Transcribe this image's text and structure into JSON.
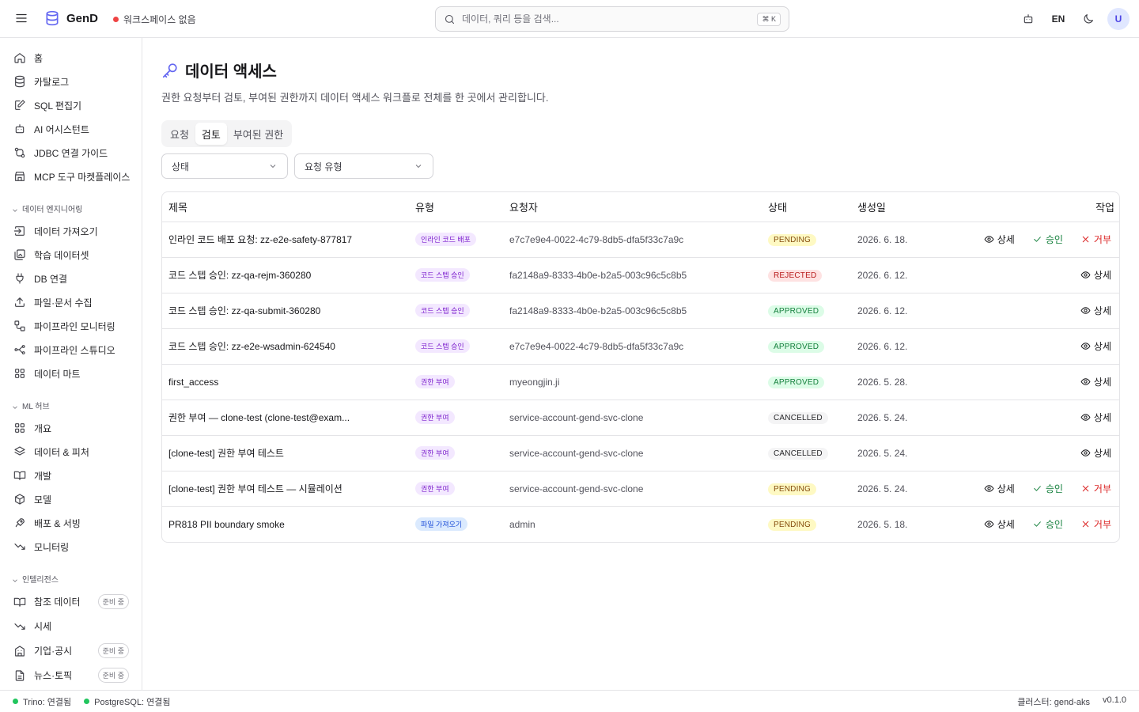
{
  "header": {
    "app_name": "GenD",
    "workspace": "워크스페이스 없음",
    "search_placeholder": "데이터, 쿼리 등을 검색...",
    "search_shortcut": "⌘ K",
    "lang": "EN",
    "avatar_initial": "U"
  },
  "sidebar": {
    "top_items": [
      {
        "label": "홈",
        "icon": "home-icon"
      },
      {
        "label": "카탈로그",
        "icon": "database-icon"
      },
      {
        "label": "SQL 편집기",
        "icon": "edit-icon"
      },
      {
        "label": "AI 어시스턴트",
        "icon": "bot-icon"
      },
      {
        "label": "JDBC 연결 가이드",
        "icon": "link-icon"
      },
      {
        "label": "MCP 도구 마켓플레이스",
        "icon": "store-icon"
      }
    ],
    "sections": [
      {
        "label": "데이터 엔지니어링",
        "items": [
          {
            "label": "데이터 가져오기",
            "icon": "import-icon"
          },
          {
            "label": "학습 데이터셋",
            "icon": "images-icon"
          },
          {
            "label": "DB 연결",
            "icon": "plug-icon"
          },
          {
            "label": "파일·문서 수집",
            "icon": "upload-icon"
          },
          {
            "label": "파이프라인 모니터링",
            "icon": "workflow-icon"
          },
          {
            "label": "파이프라인 스튜디오",
            "icon": "pipeline-icon"
          },
          {
            "label": "데이터 마트",
            "icon": "grid-icon"
          }
        ]
      },
      {
        "label": "ML 허브",
        "items": [
          {
            "label": "개요",
            "icon": "grid-icon"
          },
          {
            "label": "데이터 & 피처",
            "icon": "layers-icon"
          },
          {
            "label": "개발",
            "icon": "book-icon"
          },
          {
            "label": "모델",
            "icon": "box-icon"
          },
          {
            "label": "배포 & 서빙",
            "icon": "rocket-icon"
          },
          {
            "label": "모니터링",
            "icon": "trending-down-icon"
          }
        ]
      },
      {
        "label": "인텔리전스",
        "items": [
          {
            "label": "참조 데이터",
            "icon": "book-icon",
            "badge": "준비 중"
          },
          {
            "label": "시세",
            "icon": "trending-down-icon"
          },
          {
            "label": "기업·공시",
            "icon": "building-icon",
            "badge": "준비 중"
          },
          {
            "label": "뉴스·토픽",
            "icon": "file-icon",
            "badge": "준비 중"
          }
        ]
      }
    ]
  },
  "page": {
    "title": "데이터 액세스",
    "subtitle": "권한 요청부터 검토, 부여된 권한까지 데이터 액세스 워크플로 전체를 한 곳에서 관리합니다.",
    "tabs": [
      "요청",
      "검토",
      "부여된 권한"
    ],
    "active_tab": "검토",
    "filters": {
      "status": "상태",
      "request_type": "요청 유형"
    }
  },
  "table": {
    "columns": [
      "제목",
      "유형",
      "요청자",
      "상태",
      "생성일",
      "작업"
    ],
    "actions": {
      "view": "상세",
      "approve": "승인",
      "reject": "거부"
    },
    "rows": [
      {
        "title": "인라인 코드 배포 요청: zz-e2e-safety-877817",
        "type": "인라인 코드 배포",
        "type_color": "purple",
        "requester": "e7c7e9e4-0022-4c79-8db5-dfa5f33c7a9c",
        "status": "PENDING",
        "date": "2026. 6. 18."
      },
      {
        "title": "코드 스텝 승인: zz-qa-rejm-360280",
        "type": "코드 스텝 승인",
        "type_color": "purple",
        "requester": "fa2148a9-8333-4b0e-b2a5-003c96c5c8b5",
        "status": "REJECTED",
        "date": "2026. 6. 12."
      },
      {
        "title": "코드 스텝 승인: zz-qa-submit-360280",
        "type": "코드 스텝 승인",
        "type_color": "purple",
        "requester": "fa2148a9-8333-4b0e-b2a5-003c96c5c8b5",
        "status": "APPROVED",
        "date": "2026. 6. 12."
      },
      {
        "title": "코드 스텝 승인: zz-e2e-wsadmin-624540",
        "type": "코드 스텝 승인",
        "type_color": "purple",
        "requester": "e7c7e9e4-0022-4c79-8db5-dfa5f33c7a9c",
        "status": "APPROVED",
        "date": "2026. 6. 12."
      },
      {
        "title": "first_access",
        "type": "권한 부여",
        "type_color": "purple",
        "requester": "myeongjin.ji",
        "status": "APPROVED",
        "date": "2026. 5. 28."
      },
      {
        "title": "권한 부여 — clone-test (clone-test@exam...",
        "type": "권한 부여",
        "type_color": "purple",
        "requester": "service-account-gend-svc-clone",
        "status": "CANCELLED",
        "date": "2026. 5. 24."
      },
      {
        "title": "[clone-test] 권한 부여 테스트",
        "type": "권한 부여",
        "type_color": "purple",
        "requester": "service-account-gend-svc-clone",
        "status": "CANCELLED",
        "date": "2026. 5. 24."
      },
      {
        "title": "[clone-test] 권한 부여 테스트 — 시뮬레이션",
        "type": "권한 부여",
        "type_color": "purple",
        "requester": "service-account-gend-svc-clone",
        "status": "PENDING",
        "date": "2026. 5. 24."
      },
      {
        "title": "PR818 PII boundary smoke",
        "type": "파일 가져오기",
        "type_color": "blue",
        "requester": "admin",
        "status": "PENDING",
        "date": "2026. 5. 18."
      }
    ]
  },
  "statusbar": {
    "trino": "Trino: 연결됨",
    "postgres": "PostgreSQL: 연결됨",
    "cluster": "클러스터: gend-aks",
    "version": "v0.1.0"
  },
  "colors": {
    "accent": "#6366f1",
    "connected": "#22c55e",
    "workspace_dot": "#ef4444"
  }
}
